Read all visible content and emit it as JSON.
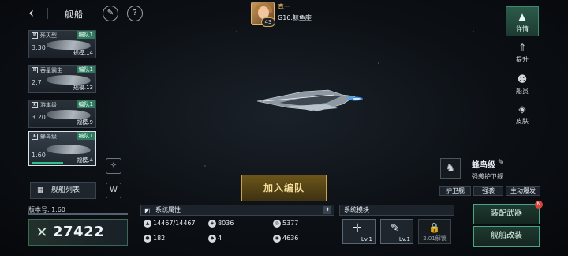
{
  "header": {
    "title": "舰船",
    "back_icon": "‹",
    "edit_icon": "✎",
    "help_icon": "?"
  },
  "player": {
    "name": "真一",
    "level": "43",
    "location": "G16.鲸鱼座"
  },
  "ships": [
    {
      "name": "歼灭型",
      "fleet": "编队1",
      "power": "3.30",
      "scale": "规模.14",
      "icon": "⊠"
    },
    {
      "name": "吞星霸主",
      "fleet": "编队1",
      "power": "2.7",
      "scale": "规模.13",
      "icon": "⊠"
    },
    {
      "name": "游隼级",
      "fleet": "编队1",
      "power": "3.20",
      "scale": "规模.9",
      "icon": "♜"
    },
    {
      "name": "蜂鸟级",
      "fleet": "编队1",
      "power": "1.60",
      "scale": "规模.4",
      "icon": "♞"
    }
  ],
  "fleet_list_label": "舰船列表",
  "version_label": "版本号. 1.60",
  "combat_power": "27422",
  "add_fleet_label": "加入编队",
  "attributes": {
    "title": "系统属性",
    "items": [
      {
        "icon": "▲",
        "value": "14467/14467"
      },
      {
        "icon": "◈",
        "value": "8036"
      },
      {
        "icon": "◎",
        "value": "5377"
      },
      {
        "icon": "●",
        "value": "182"
      },
      {
        "icon": "◆",
        "value": "4"
      },
      {
        "icon": "◉",
        "value": "4636"
      }
    ]
  },
  "modules": {
    "title": "系统模块",
    "items": [
      {
        "icon": "✛",
        "label": "Lv.1"
      },
      {
        "icon": "✎",
        "label": "Lv.1"
      },
      {
        "icon": "🔒",
        "label": "2.01解锁"
      }
    ]
  },
  "nav": [
    {
      "label": "详情",
      "icon": "▲"
    },
    {
      "label": "提升",
      "icon": "⇑"
    },
    {
      "label": "船员",
      "icon": "☻"
    },
    {
      "label": "皮肤",
      "icon": "◈"
    }
  ],
  "ship_class": {
    "name": "蜂鸟级",
    "subtitle": "强袭护卫舰",
    "tags": [
      "护卫舰",
      "强袭",
      "主动爆发"
    ]
  },
  "buttons": {
    "equip": "装配武器",
    "modify": "舰船改装",
    "new_badge": "N"
  }
}
